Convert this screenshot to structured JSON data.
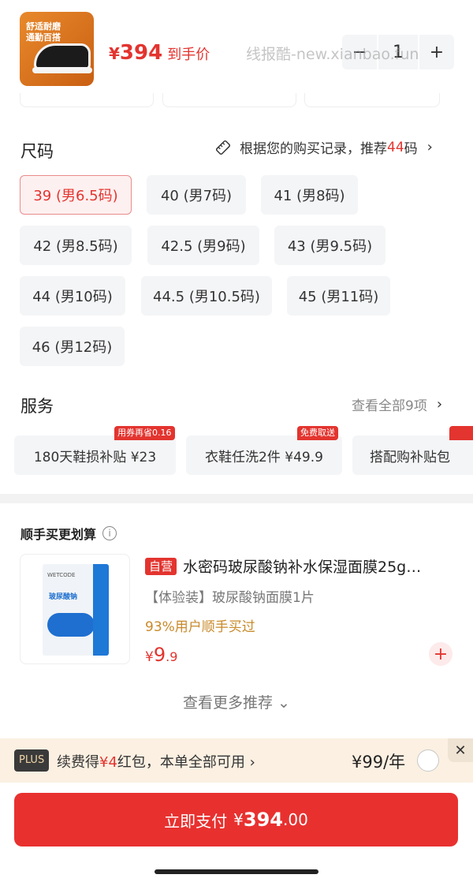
{
  "header": {
    "thumb_lines": [
      "舒适耐磨",
      "通勤百搭"
    ],
    "price_currency": "¥",
    "price_value": "394",
    "price_label": "到手价",
    "watermark": "线报酷-new.xianbao.fun",
    "quantity": "1",
    "minus": "−",
    "plus": "+"
  },
  "size": {
    "title": "尺码",
    "hint_prefix": "根据您的购买记录，推荐",
    "hint_value": "44",
    "hint_suffix": "码",
    "chevron": "›",
    "options": [
      "39 (男6.5码)",
      "40 (男7码)",
      "41 (男8码)",
      "42 (男8.5码)",
      "42.5 (男9码)",
      "43 (男9.5码)",
      "44 (男10码)",
      "44.5 (男10.5码)",
      "45 (男11码)",
      "46 (男12码)"
    ],
    "selected": "39 (男6.5码)"
  },
  "service": {
    "title": "服务",
    "more": "查看全部9项",
    "chevron": "›",
    "items": [
      {
        "label": "180天鞋损补贴  ¥23",
        "badge": "用券再省0.16"
      },
      {
        "label": "衣鞋任洗2件  ¥49.9",
        "badge": "免费取送"
      },
      {
        "label": "搭配购补贴包",
        "badge": ""
      }
    ]
  },
  "recommend": {
    "title": "顺手买更划算",
    "info": "i",
    "product": {
      "tag": "自营",
      "name": "水密码玻尿酸钠补水保湿面膜25g…",
      "subtitle": "【体验装】玻尿酸钠面膜1片",
      "buy_rate": "93%用户顺手买过",
      "price_currency": "¥",
      "price_int": "9",
      "price_dec": ".9",
      "add": "+",
      "image_brand": "WETCODE",
      "image_text": "玻尿酸钠"
    },
    "see_more": "查看更多推荐 ⌄"
  },
  "plus": {
    "tag": "PLUS",
    "text_prefix": "续费得",
    "text_highlight": "¥4",
    "text_suffix": "红包，本单全部可用 ›",
    "price": "¥99/年",
    "close": "✕"
  },
  "pay": {
    "label": "立即支付",
    "currency": "¥",
    "amount_int": "394",
    "amount_dec": ".00"
  },
  "colors": {
    "accent": "#e3342f",
    "gold": "#c88a2a",
    "chip_bg": "#f4f5f7"
  }
}
